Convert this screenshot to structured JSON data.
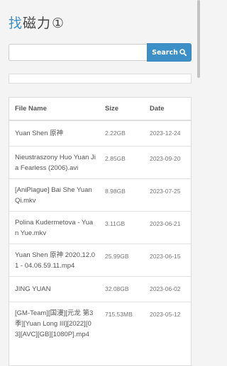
{
  "header": {
    "logo_accent": "找",
    "logo_rest": "磁力",
    "logo_circled": "①"
  },
  "search": {
    "value": "",
    "placeholder": "",
    "button_label": "Search"
  },
  "colors": {
    "accent": "#3d8fc7",
    "button_text": "#ffffff"
  },
  "table": {
    "headers": {
      "name": "File Name",
      "size": "Size",
      "date": "Date"
    },
    "rows": [
      {
        "name": "Yuan Shen 原神",
        "size": "2.22GB",
        "date": "2023-12-24"
      },
      {
        "name": "Nieustraszony Huo Yuan Jia Fearless (2006).avi",
        "size": "2.85GB",
        "date": "2023-09-20"
      },
      {
        "name": "[AniPlague] Bai She Yuan Qi.mkv",
        "size": "8.98GB",
        "date": "2023-07-25"
      },
      {
        "name": "Polina Kudermetova - Yuan Yue.mkv",
        "size": "3.11GB",
        "date": "2023-06-21"
      },
      {
        "name": "Yuan Shen 原神 2020.12.01 - 04.06.59.11.mp4",
        "size": "25.99GB",
        "date": "2023-06-15"
      },
      {
        "name": "JING YUAN",
        "size": "32.08GB",
        "date": "2023-06-02"
      },
      {
        "name": "[GM-Team][国漫][元龙 第3季][Yuan Long III][2022][03][AVC][GB][1080P].mp4",
        "size": "715.53MB",
        "date": "2023-05-12"
      }
    ]
  },
  "icons": {
    "search": "search-icon"
  }
}
